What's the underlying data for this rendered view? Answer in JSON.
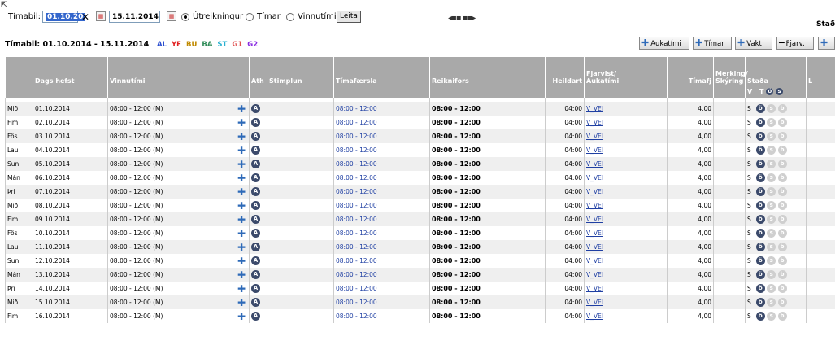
{
  "filter": {
    "label": "Tímabil:",
    "date_from": "01.10.20",
    "date_to": "15.11.2014",
    "clear_glyph": "✕",
    "radio_options": [
      "Útreikningur",
      "Tímar",
      "Vinnutími"
    ],
    "selected_radio": "Útreikningur",
    "search_label": "Leita",
    "nav_arrows": "◂▪▪ ▪▪▸",
    "cut_text": "Stað"
  },
  "period": {
    "title": "Tímabil: 01.10.2014 - 15.11.2014",
    "legend": [
      {
        "code": "AL",
        "color": "#2b4ecf"
      },
      {
        "code": "YF",
        "color": "#e02020"
      },
      {
        "code": "BU",
        "color": "#c08a00"
      },
      {
        "code": "BA",
        "color": "#2e8b57"
      },
      {
        "code": "ST",
        "color": "#28b0d0"
      },
      {
        "code": "G1",
        "color": "#e05050"
      },
      {
        "code": "G2",
        "color": "#8a2be2"
      }
    ]
  },
  "toolbar": [
    {
      "label": "Aukatími",
      "icon": "plus-icon"
    },
    {
      "label": "Tímar",
      "icon": "plus-icon"
    },
    {
      "label": "Vakt",
      "icon": "plus-icon"
    },
    {
      "label": "Fjarv.",
      "icon": "minus-icon"
    },
    {
      "label": "",
      "icon": "plus-icon"
    }
  ],
  "table": {
    "headers": [
      "",
      "Dags hefst",
      "Vinnutími",
      "Ath",
      "Stimplun",
      "Tímafærsla",
      "Reiknifors",
      "Heildart",
      "Fjarvist/\nAukatími",
      "Tímafj",
      "Merking/\nSkýring",
      "Staða",
      "L"
    ],
    "sub_headers": {
      "v": "V",
      "t": "T"
    },
    "rows": [
      {
        "day": "Mið",
        "date": "01.10.2014"
      },
      {
        "day": "Fim",
        "date": "02.10.2014"
      },
      {
        "day": "Fös",
        "date": "03.10.2014"
      },
      {
        "day": "Lau",
        "date": "04.10.2014"
      },
      {
        "day": "Sun",
        "date": "05.10.2014"
      },
      {
        "day": "Mán",
        "date": "06.10.2014"
      },
      {
        "day": "Þri",
        "date": "07.10.2014"
      },
      {
        "day": "Mið",
        "date": "08.10.2014"
      },
      {
        "day": "Fim",
        "date": "09.10.2014"
      },
      {
        "day": "Fös",
        "date": "10.10.2014"
      },
      {
        "day": "Lau",
        "date": "11.10.2014"
      },
      {
        "day": "Sun",
        "date": "12.10.2014"
      },
      {
        "day": "Mán",
        "date": "13.10.2014"
      },
      {
        "day": "Þri",
        "date": "14.10.2014"
      },
      {
        "day": "Mið",
        "date": "15.10.2014"
      },
      {
        "day": "Fim",
        "date": "16.10.2014"
      }
    ],
    "row_common": {
      "work": "08:00 - 12:00 (M)",
      "entry": "08:00 - 12:00",
      "calc": "08:00 - 12:00",
      "total": "04:00",
      "code": "V_VEI",
      "hours": "4,00",
      "status": "S"
    }
  }
}
